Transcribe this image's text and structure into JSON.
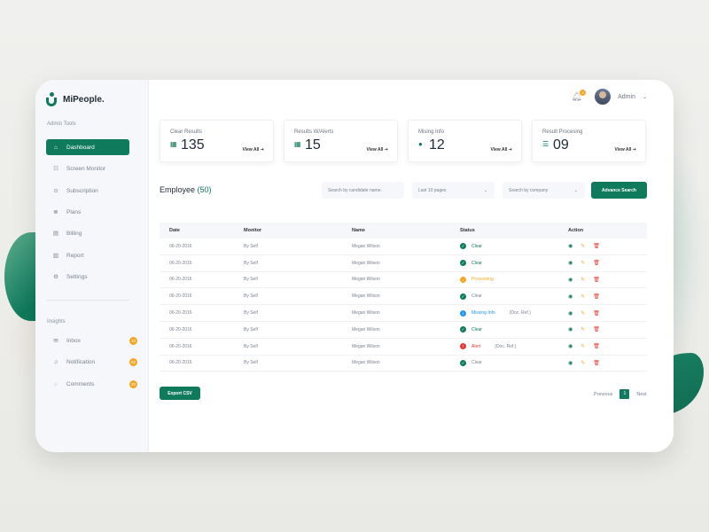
{
  "app": {
    "name": "MiPeople."
  },
  "sidebar": {
    "section_admin": "Admin Tools",
    "items": [
      {
        "label": "Dashboard",
        "icon": "home-icon",
        "active": true
      },
      {
        "label": "Screen Monitor",
        "icon": "users-icon"
      },
      {
        "label": "Subscription",
        "icon": "subscription-icon"
      },
      {
        "label": "Plans",
        "icon": "plans-icon"
      },
      {
        "label": "Billing",
        "icon": "billing-icon"
      },
      {
        "label": "Report",
        "icon": "report-icon"
      },
      {
        "label": "Settings",
        "icon": "settings-icon"
      }
    ],
    "section_insights": "Insights",
    "insights": [
      {
        "label": "Inbox",
        "icon": "inbox-icon",
        "badge": "10"
      },
      {
        "label": "Notification",
        "icon": "bell-icon",
        "badge": "02"
      },
      {
        "label": "Comments",
        "icon": "comment-icon",
        "badge": "20"
      }
    ]
  },
  "header": {
    "notification_count": "2",
    "user_name": "Admin"
  },
  "cards": [
    {
      "title": "Clear Results",
      "value": "135",
      "link": "View All",
      "icon": "document-icon"
    },
    {
      "title": "Results W/Alerts",
      "value": "15",
      "link": "View All",
      "icon": "document-icon"
    },
    {
      "title": "Mising Info",
      "value": "12",
      "link": "View All",
      "icon": "info-icon"
    },
    {
      "title": "Result Procesing",
      "value": "09",
      "link": "View All",
      "icon": "list-icon"
    }
  ],
  "employee": {
    "title": "Employee",
    "count": "(50)",
    "search_placeholder": "Search by candidate name.",
    "pages_filter": "Last 10 pages",
    "company_filter": "Search by company",
    "advance_search": "Advance Search"
  },
  "table": {
    "headers": [
      "Date",
      "Monitor",
      "Name",
      "Status",
      "Action"
    ],
    "rows": [
      {
        "date": "06-20-2016",
        "monitor": "By Self",
        "name": "Megan Wilson",
        "status": "Clear",
        "status_type": "clear-green",
        "extra": ""
      },
      {
        "date": "06-20-2016",
        "monitor": "By Self",
        "name": "Megan Wilson",
        "status": "Clear",
        "status_type": "clear-green",
        "extra": ""
      },
      {
        "date": "06-20-2016",
        "monitor": "By Self",
        "name": "Megan Wilson",
        "status": "Processing",
        "status_type": "processing",
        "extra": ""
      },
      {
        "date": "06-20-2016",
        "monitor": "By Self",
        "name": "Megan Wilson",
        "status": "Clear",
        "status_type": "clear-grey",
        "extra": ""
      },
      {
        "date": "06-20-2016",
        "monitor": "By Self",
        "name": "Megan Wilson",
        "status": "Missing Info",
        "status_type": "missing",
        "extra": "(Doc. Ref.)"
      },
      {
        "date": "06-20-2016",
        "monitor": "By Self",
        "name": "Megan Wilson",
        "status": "Clear",
        "status_type": "clear-green",
        "extra": ""
      },
      {
        "date": "06-20-2016",
        "monitor": "By Self",
        "name": "Megan Wilson",
        "status": "Alert",
        "status_type": "alert",
        "extra": "(Doc. Ref.)"
      },
      {
        "date": "06-20-2016",
        "monitor": "By Self",
        "name": "Megan Wilson",
        "status": "Clear",
        "status_type": "clear-grey",
        "extra": ""
      }
    ]
  },
  "footer": {
    "export_label": "Export CSV",
    "previous": "Previous",
    "page": "1",
    "next": "Next"
  },
  "colors": {
    "primary": "#0f7a5c",
    "warning": "#f5a623",
    "danger": "#e53935",
    "info": "#2196f3"
  }
}
